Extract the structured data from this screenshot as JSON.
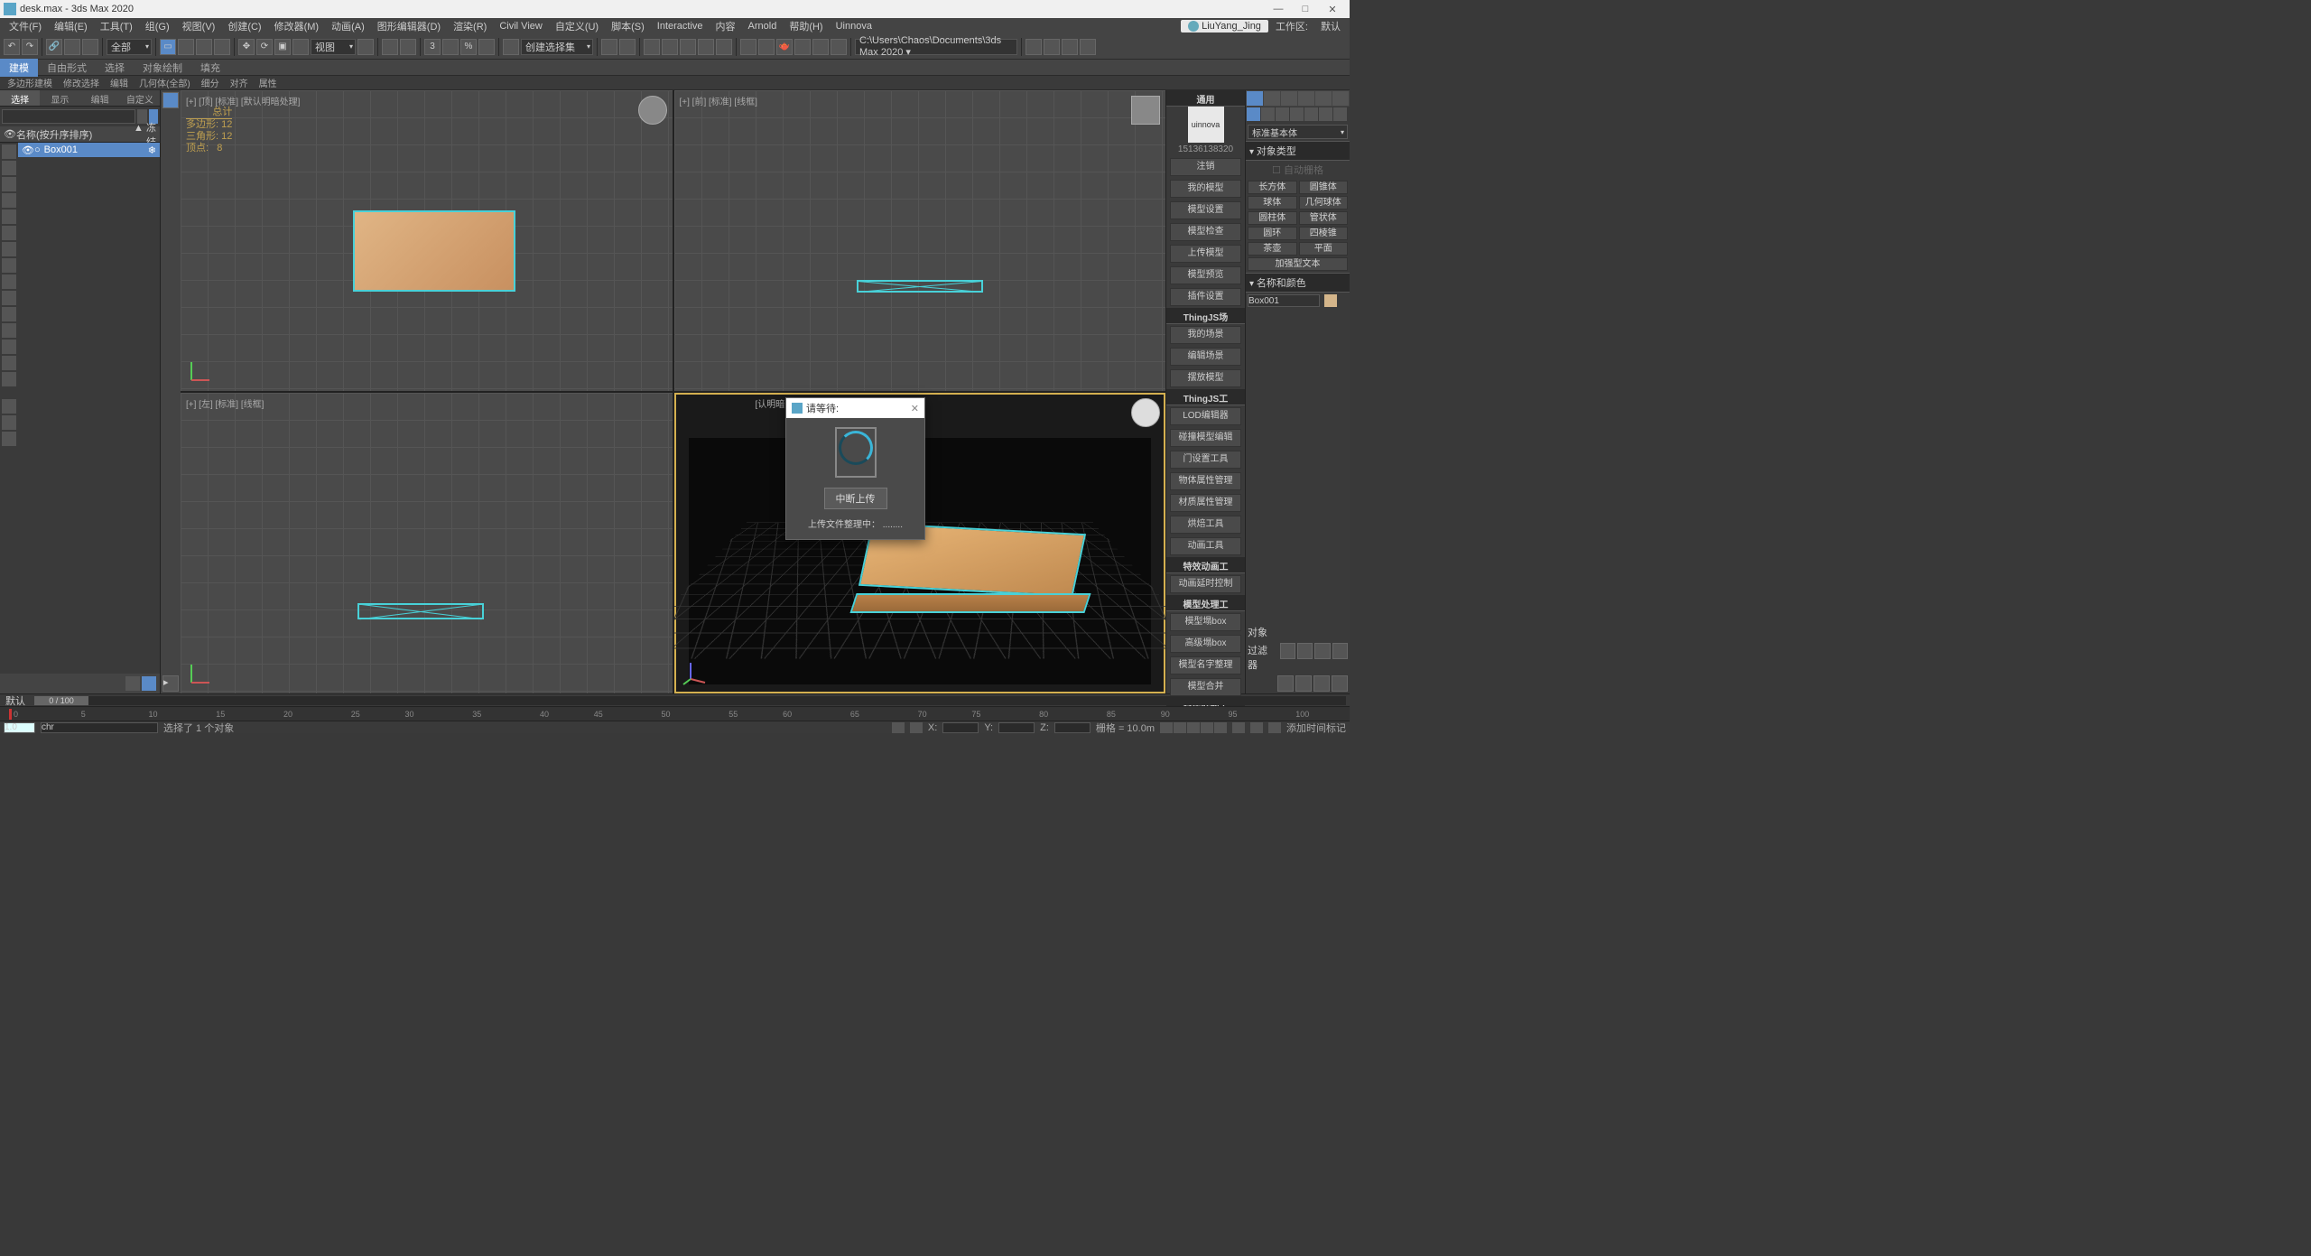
{
  "title": "desk.max - 3ds Max 2020",
  "menus": [
    "文件(F)",
    "编辑(E)",
    "工具(T)",
    "组(G)",
    "视图(V)",
    "创建(C)",
    "修改器(M)",
    "动画(A)",
    "图形编辑器(D)",
    "渲染(R)",
    "Civil View",
    "自定义(U)",
    "脚本(S)",
    "Interactive",
    "内容",
    "Arnold",
    "帮助(H)",
    "Uinnova"
  ],
  "user": "LiuYang_Jing",
  "workspace_label": "工作区:",
  "workspace_value": "默认",
  "tb_dropdown_all": "全部",
  "tb_dropdown_view": "视图",
  "tb_dropdown_selset": "创建选择集",
  "project_path": "C:\\Users\\Chaos\\Documents\\3ds Max 2020 ▾",
  "ribbon_tabs": [
    "建模",
    "自由形式",
    "选择",
    "对象绘制",
    "填充"
  ],
  "ribbon2": [
    "多边形建模",
    "修改选择",
    "编辑",
    "几何体(全部)",
    "细分",
    "对齐",
    "属性"
  ],
  "scene_tabs": [
    "选择",
    "显示",
    "编辑",
    "自定义"
  ],
  "scene_hdr_name": "名称(按升序排序)",
  "scene_hdr_frozen": "▲ 冻结",
  "scene_item": "Box001",
  "vp_top": "[+] [顶] [标准] [默认明暗处理]",
  "vp_front": "[+] [前] [标准] [线框]",
  "vp_left": "[+] [左] [标准] [线框]",
  "vp_persp": "[认明暗处理]",
  "stats": {
    "title": "总计",
    "poly_l": "多边形:",
    "poly_v": "12",
    "tri_l": "三角形:",
    "tri_v": "12",
    "vert_l": "顶点:",
    "vert_v": "8"
  },
  "dialog": {
    "title": "请等待:",
    "btn": "中断上传",
    "status": "上传文件整理中：  ........"
  },
  "rp": {
    "general": "通用",
    "logo": "uinnova",
    "id": "15136138320",
    "btns1": [
      "注销",
      "我的模型",
      "模型设置",
      "模型检查",
      "上传模型",
      "模型预览",
      "插件设置"
    ],
    "sec2": "ThingJS场",
    "btns2": [
      "我的场景",
      "编辑场景",
      "摆放模型"
    ],
    "sec3": "ThingJS工",
    "btns3": [
      "LOD编辑器",
      "碰撞模型编辑",
      "门设置工具",
      "物体属性管理",
      "材质属性管理",
      "烘焙工具",
      "动画工具"
    ],
    "sec4": "特效动画工",
    "btns4": [
      "动画延时控制"
    ],
    "sec5": "模型处理工",
    "btns5": [
      "模型塌box",
      "高级塌box",
      "模型名字整理",
      "模型合并"
    ],
    "sec6": "材质贴图工"
  },
  "cr": {
    "dropdown": "标准基本体",
    "roll1": "对象类型",
    "autogrid": "自动栅格",
    "prims": [
      "长方体",
      "圆锥体",
      "球体",
      "几何球体",
      "圆柱体",
      "管状体",
      "圆环",
      "四棱锥",
      "茶壶",
      "平面",
      "加强型文本"
    ],
    "roll2": "名称和颜色",
    "name": "Box001"
  },
  "timeslider": "0 / 100",
  "timeline_ticks": [
    "0",
    "5",
    "10",
    "15",
    "20",
    "25",
    "30",
    "35",
    "40",
    "45",
    "50",
    "55",
    "60",
    "65",
    "70",
    "75",
    "80",
    "85",
    "90",
    "95",
    "100"
  ],
  "status": {
    "frame": "1.0",
    "script": "chr",
    "sel": "选择了 1 个对象",
    "xl": "X:",
    "yl": "Y:",
    "zl": "Z:",
    "grid": "栅格 = 10.0m",
    "addtime": "添加时间标记",
    "guolv": "过滤器",
    "default": "默认",
    "xiang": "对象"
  }
}
